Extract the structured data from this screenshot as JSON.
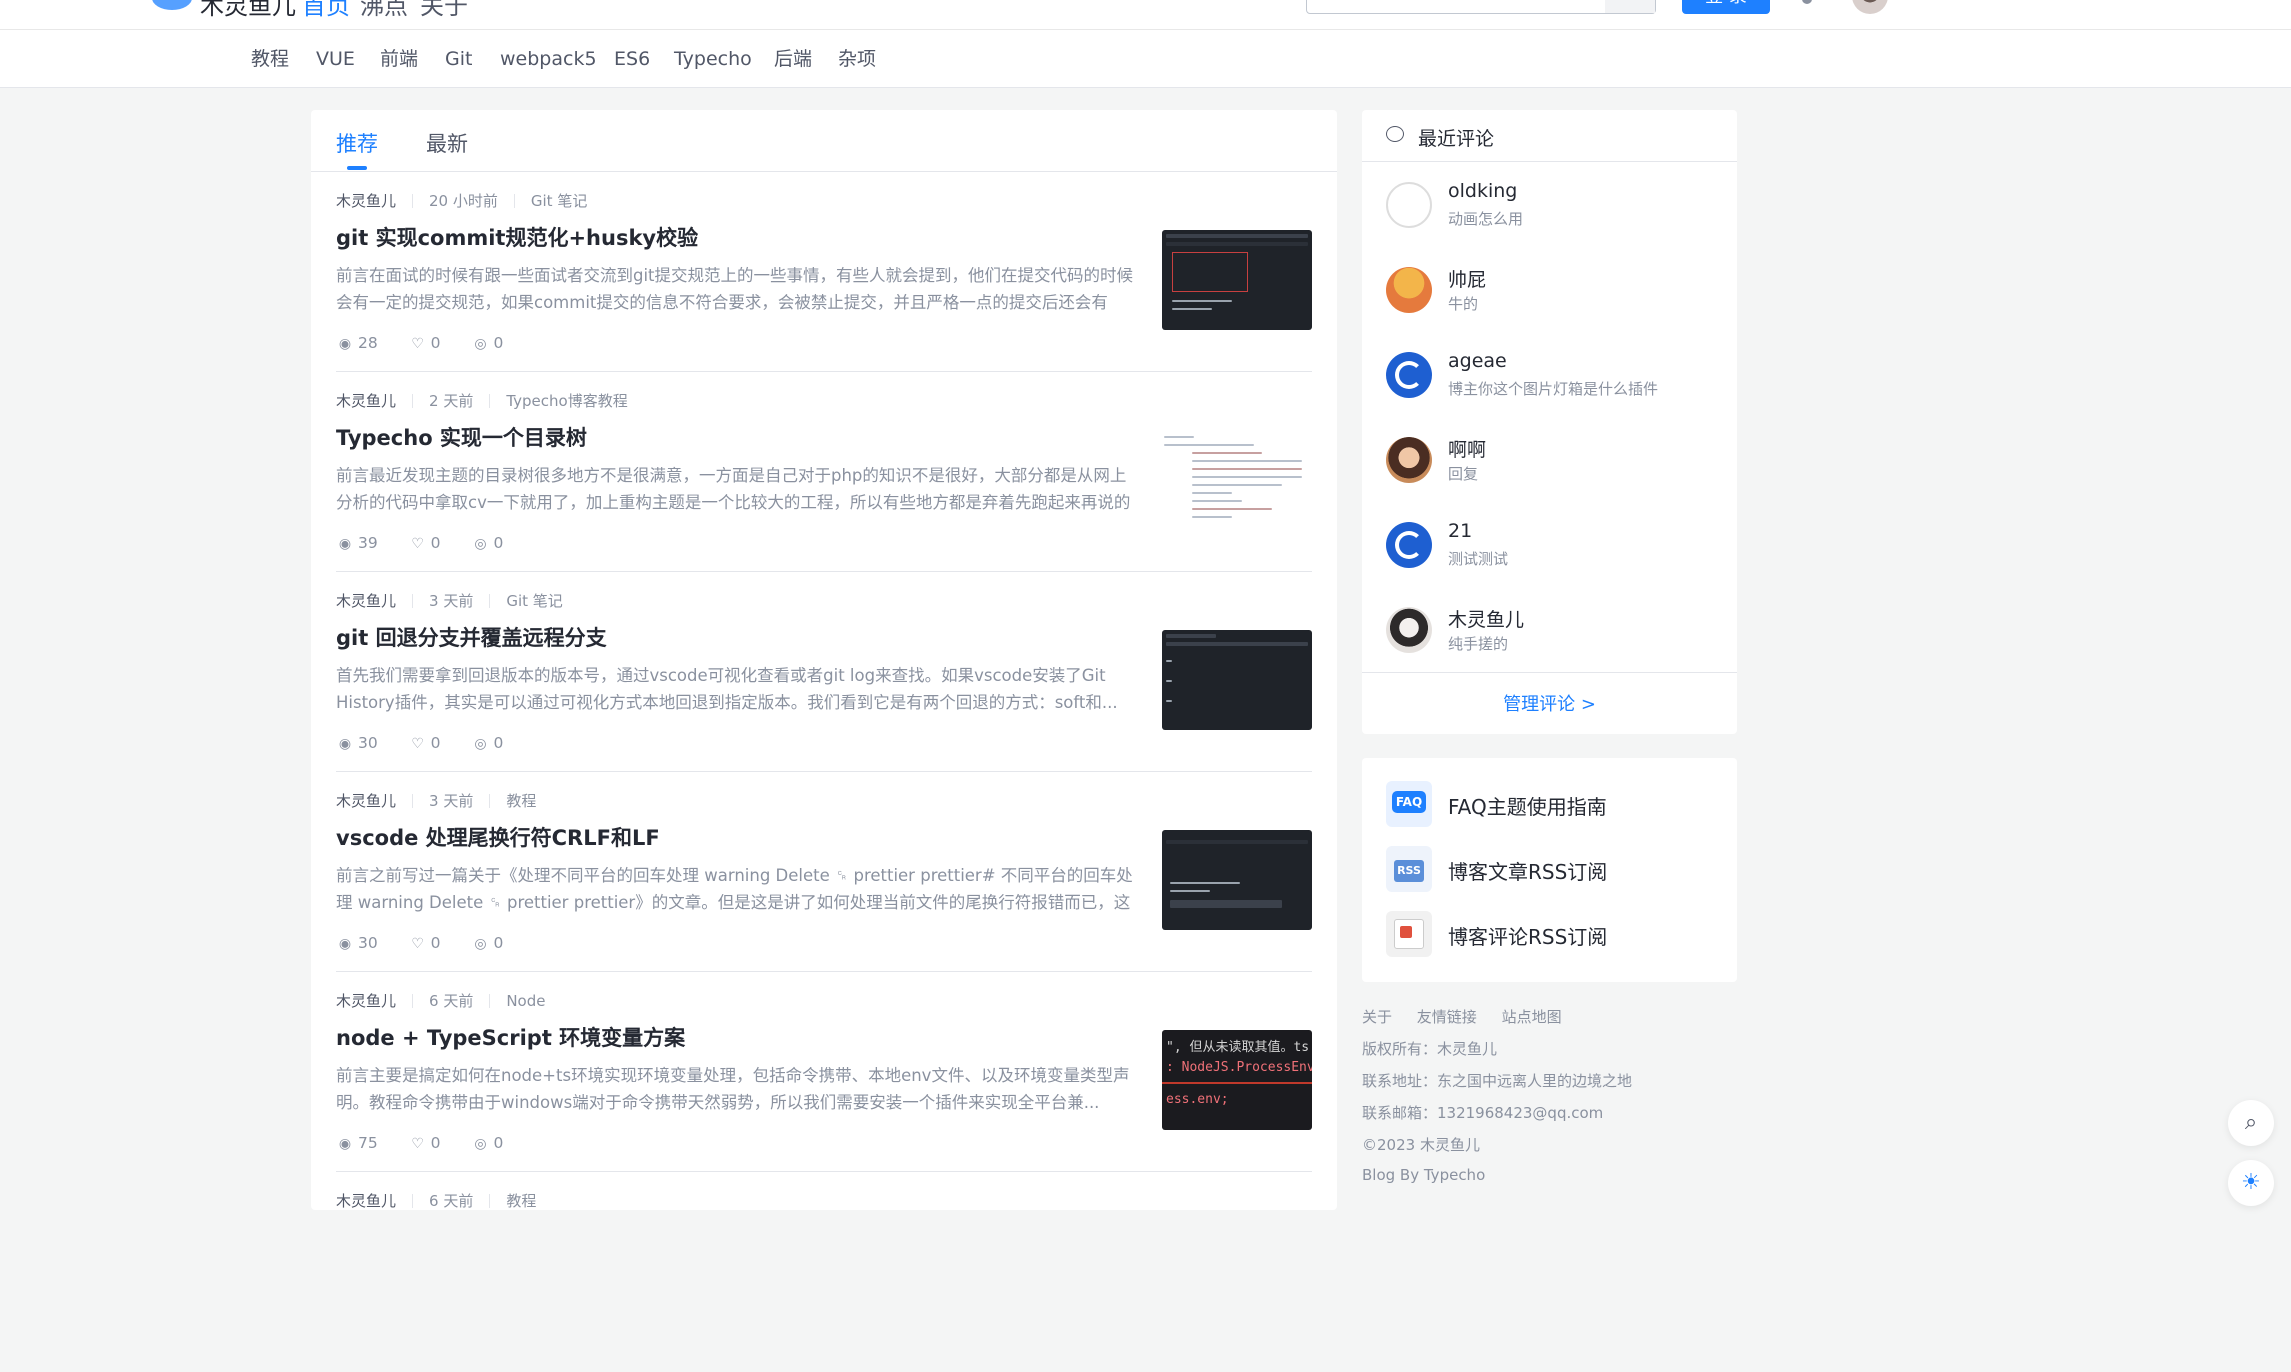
{
  "header": {
    "logo_text": "木灵鱼儿",
    "nav": [
      "首页",
      "沸点",
      "关于"
    ],
    "login_label": "登 录"
  },
  "categories": [
    "教程",
    "VUE",
    "前端",
    "Git",
    "webpack5",
    "ES6",
    "Typecho",
    "后端",
    "杂项"
  ],
  "feed": {
    "tabs": [
      "推荐",
      "最新"
    ],
    "articles": [
      {
        "author": "木灵鱼儿",
        "time": "20 小时前",
        "category": "Git 笔记",
        "title": "git 实现commit规范化+husky校验",
        "abstract": "前言在面试的时候有跟一些面试者交流到git提交规范上的一些事情，有些人就会提到，他们在提交代码的时候会有一定的提交规范，如果commit提交的信息不符合要求，会被禁止提交，并且严格一点的提交后还会有人...",
        "views": "28",
        "likes": "0",
        "comments": "0"
      },
      {
        "author": "木灵鱼儿",
        "time": "2 天前",
        "category": "Typecho博客教程",
        "title": "Typecho 实现一个目录树",
        "abstract": "前言最近发现主题的目录树很多地方不是很满意，一方面是自己对于php的知识不是很好，大部分都是从网上分析的代码中拿取cv一下就用了，加上重构主题是一个比较大的工程，所以有些地方都是弃着先跑起来再说的思...",
        "views": "39",
        "likes": "0",
        "comments": "0"
      },
      {
        "author": "木灵鱼儿",
        "time": "3 天前",
        "category": "Git 笔记",
        "title": "git 回退分支并覆盖远程分支",
        "abstract": "首先我们需要拿到回退版本的版本号，通过vscode可视化查看或者git log来查找。如果vscode安装了Git History插件，其实是可以通过可视化方式本地回退到指定版本。我们看到它是有两个回退的方式：soft和...",
        "views": "30",
        "likes": "0",
        "comments": "0"
      },
      {
        "author": "木灵鱼儿",
        "time": "3 天前",
        "category": "教程",
        "title": "vscode 处理尾换行符CRLF和LF",
        "abstract": "前言之前写过一篇关于《处理不同平台的回车处理 warning Delete ␍ prettier prettier# 不同平台的回车处理 warning Delete ␍ prettier prettier》的文章。但是这是讲了如何处理当前文件的尾换行符报错而已，这次分...",
        "views": "30",
        "likes": "0",
        "comments": "0"
      },
      {
        "author": "木灵鱼儿",
        "time": "6 天前",
        "category": "Node",
        "title": "node + TypeScript 环境变量方案",
        "abstract": "前言主要是搞定如何在node+ts环境实现环境变量处理，包括命令携带、本地env文件、以及环境变量类型声明。教程命令携带由于windows端对于命令携带天然弱势，所以我们需要安装一个插件来实现全平台兼...",
        "views": "75",
        "likes": "0",
        "comments": "0"
      },
      {
        "author": "木灵鱼儿",
        "time": "6 天前",
        "category": "教程",
        "title": "",
        "abstract": "",
        "views": "",
        "likes": "",
        "comments": ""
      }
    ],
    "thumb_code": {
      "line1": "\", 但从未读取其值。ts",
      "line2": ": NodeJS.ProcessEnv",
      "line3": "ess.env;"
    }
  },
  "recent_comments": {
    "title": "最近评论",
    "items": [
      {
        "name": "oldking",
        "text": "动画怎么用"
      },
      {
        "name": "帅屁",
        "text": "牛的"
      },
      {
        "name": "ageae",
        "text": "博主你这个图片灯箱是什么插件"
      },
      {
        "name": "啊啊",
        "text": "回复"
      },
      {
        "name": "21",
        "text": "测试测试"
      },
      {
        "name": "木灵鱼儿",
        "text": "纯手搓的"
      }
    ],
    "manage_label": "管理评论 >"
  },
  "links": [
    {
      "label": "FAQ主题使用指南",
      "badge": "FAQ"
    },
    {
      "label": "博客文章RSS订阅",
      "badge": "RSS"
    },
    {
      "label": "博客评论RSS订阅",
      "badge": ""
    }
  ],
  "footer": {
    "links": [
      "关于",
      "友情链接",
      "站点地图"
    ],
    "copyright_owner": "版权所有：木灵鱼儿",
    "address": "联系地址：东之国中远离人里的边境之地",
    "email": "联系邮箱：1321968423@qq.com",
    "year": "©2023 木灵鱼儿",
    "powered": "Blog By Typecho"
  },
  "icons": {
    "views": "eye-icon",
    "likes": "thumb-up-icon",
    "comments": "comment-icon",
    "search": "search-icon",
    "theme": "sun-icon"
  },
  "colors": {
    "accent": "#1e80ff",
    "page_bg": "#f4f5f5",
    "text_main": "#252933",
    "text_muted": "#8a919f"
  }
}
